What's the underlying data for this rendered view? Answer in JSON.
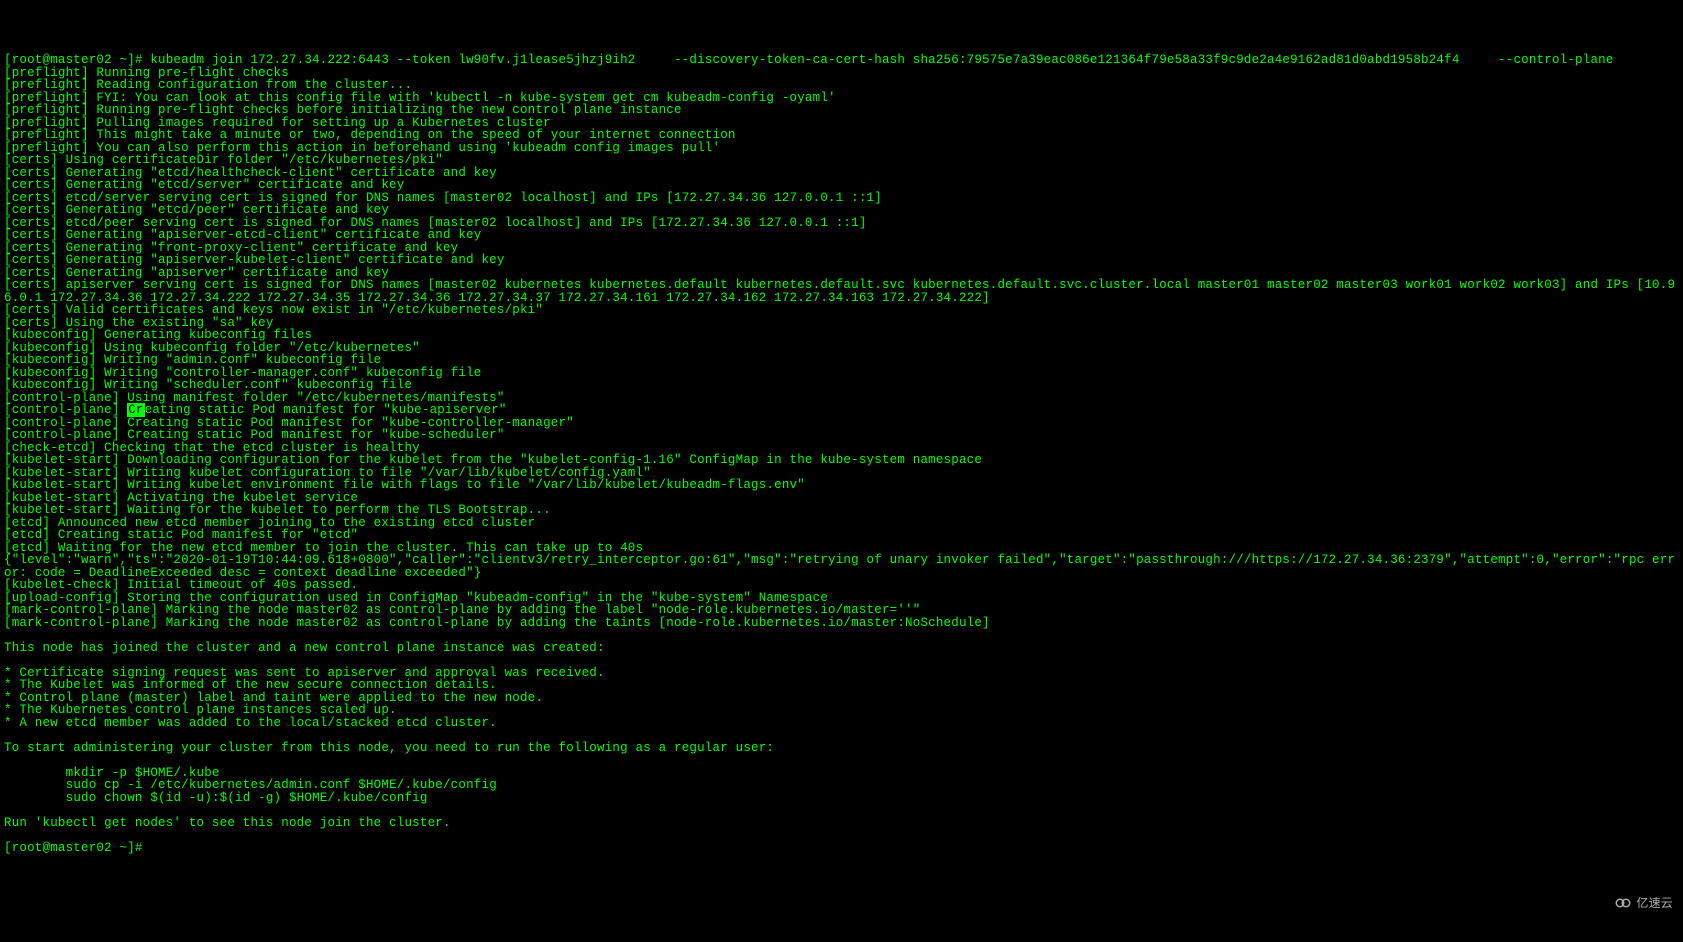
{
  "prompt": "[root@master02 ~]# ",
  "command": "kubeadm join 172.27.34.222:6443 --token lw90fv.j1lease5jhzj9ih2     --discovery-token-ca-cert-hash sha256:79575e7a39eac086e121364f79e58a33f9c9de2a4e9162ad81d0abd1958b24f4     --control-plane",
  "lines_before": [
    "[preflight] Running pre-flight checks",
    "[preflight] Reading configuration from the cluster...",
    "[preflight] FYI: You can look at this config file with 'kubectl -n kube-system get cm kubeadm-config -oyaml'",
    "[preflight] Running pre-flight checks before initializing the new control plane instance",
    "[preflight] Pulling images required for setting up a Kubernetes cluster",
    "[preflight] This might take a minute or two, depending on the speed of your internet connection",
    "[preflight] You can also perform this action in beforehand using 'kubeadm config images pull'",
    "[certs] Using certificateDir folder \"/etc/kubernetes/pki\"",
    "[certs] Generating \"etcd/healthcheck-client\" certificate and key",
    "[certs] Generating \"etcd/server\" certificate and key",
    "[certs] etcd/server serving cert is signed for DNS names [master02 localhost] and IPs [172.27.34.36 127.0.0.1 ::1]",
    "[certs] Generating \"etcd/peer\" certificate and key",
    "[certs] etcd/peer serving cert is signed for DNS names [master02 localhost] and IPs [172.27.34.36 127.0.0.1 ::1]",
    "[certs] Generating \"apiserver-etcd-client\" certificate and key",
    "[certs] Generating \"front-proxy-client\" certificate and key",
    "[certs] Generating \"apiserver-kubelet-client\" certificate and key",
    "[certs] Generating \"apiserver\" certificate and key",
    "[certs] apiserver serving cert is signed for DNS names [master02 kubernetes kubernetes.default kubernetes.default.svc kubernetes.default.svc.cluster.local master01 master02 master03 work01 work02 work03] and IPs [10.96.0.1 172.27.34.36 172.27.34.222 172.27.34.35 172.27.34.36 172.27.34.37 172.27.34.161 172.27.34.162 172.27.34.163 172.27.34.222]",
    "[certs] Valid certificates and keys now exist in \"/etc/kubernetes/pki\"",
    "[certs] Using the existing \"sa\" key",
    "[kubeconfig] Generating kubeconfig files",
    "[kubeconfig] Using kubeconfig folder \"/etc/kubernetes\"",
    "[kubeconfig] Writing \"admin.conf\" kubeconfig file",
    "[kubeconfig] Writing \"controller-manager.conf\" kubeconfig file",
    "[kubeconfig] Writing \"scheduler.conf\" kubeconfig file",
    "[control-plane] Using manifest folder \"/etc/kubernetes/manifests\""
  ],
  "highlight_line": {
    "prefix": "[control-plane] ",
    "hl": "Cr",
    "suffix": "eating static Pod manifest for \"kube-apiserver\""
  },
  "lines_after": [
    "[control-plane] Creating static Pod manifest for \"kube-controller-manager\"",
    "[control-plane] Creating static Pod manifest for \"kube-scheduler\"",
    "[check-etcd] Checking that the etcd cluster is healthy",
    "[kubelet-start] Downloading configuration for the kubelet from the \"kubelet-config-1.16\" ConfigMap in the kube-system namespace",
    "[kubelet-start] Writing kubelet configuration to file \"/var/lib/kubelet/config.yaml\"",
    "[kubelet-start] Writing kubelet environment file with flags to file \"/var/lib/kubelet/kubeadm-flags.env\"",
    "[kubelet-start] Activating the kubelet service",
    "[kubelet-start] Waiting for the kubelet to perform the TLS Bootstrap...",
    "[etcd] Announced new etcd member joining to the existing etcd cluster",
    "[etcd] Creating static Pod manifest for \"etcd\"",
    "[etcd] Waiting for the new etcd member to join the cluster. This can take up to 40s",
    "{\"level\":\"warn\",\"ts\":\"2020-01-19T10:44:09.618+0800\",\"caller\":\"clientv3/retry_interceptor.go:61\",\"msg\":\"retrying of unary invoker failed\",\"target\":\"passthrough:///https://172.27.34.36:2379\",\"attempt\":0,\"error\":\"rpc error: code = DeadlineExceeded desc = context deadline exceeded\"}",
    "[kubelet-check] Initial timeout of 40s passed.",
    "[upload-config] Storing the configuration used in ConfigMap \"kubeadm-config\" in the \"kube-system\" Namespace",
    "[mark-control-plane] Marking the node master02 as control-plane by adding the label \"node-role.kubernetes.io/master=''\"",
    "[mark-control-plane] Marking the node master02 as control-plane by adding the taints [node-role.kubernetes.io/master:NoSchedule]",
    "",
    "This node has joined the cluster and a new control plane instance was created:",
    "",
    "* Certificate signing request was sent to apiserver and approval was received.",
    "* The Kubelet was informed of the new secure connection details.",
    "* Control plane (master) label and taint were applied to the new node.",
    "* The Kubernetes control plane instances scaled up.",
    "* A new etcd member was added to the local/stacked etcd cluster.",
    "",
    "To start administering your cluster from this node, you need to run the following as a regular user:",
    "",
    "        mkdir -p $HOME/.kube",
    "        sudo cp -i /etc/kubernetes/admin.conf $HOME/.kube/config",
    "        sudo chown $(id -u):$(id -g) $HOME/.kube/config",
    "",
    "Run 'kubectl get nodes' to see this node join the cluster.",
    ""
  ],
  "prompt_end": "[root@master02 ~]# ",
  "watermark": "亿速云"
}
